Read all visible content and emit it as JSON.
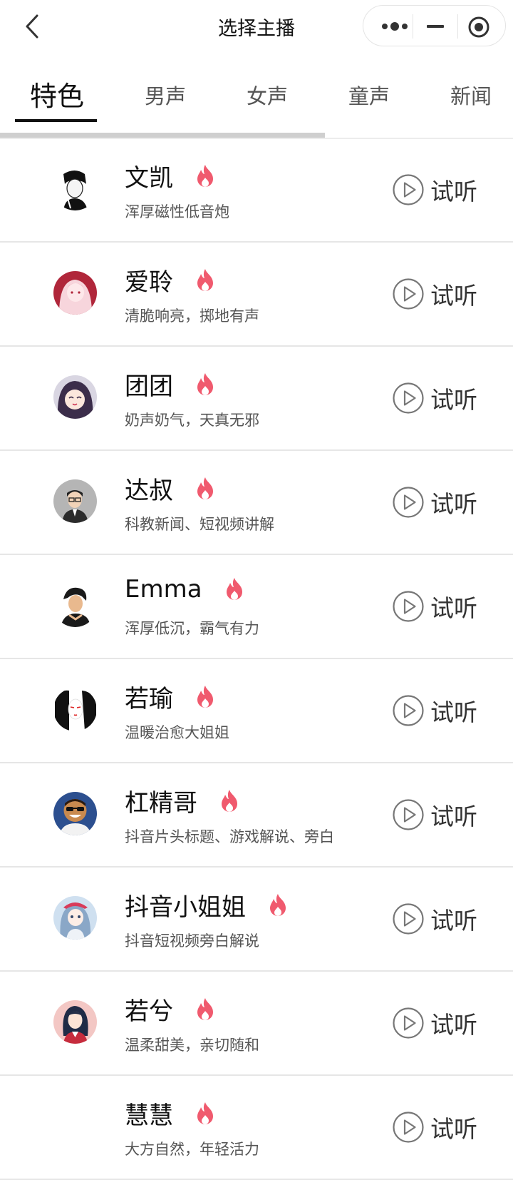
{
  "nav": {
    "title": "选择主播",
    "back_icon": "chevron-left-icon",
    "capsule": {
      "more_icon": "more-dots-icon",
      "minimize_icon": "minimize-icon",
      "close_icon": "target-circle-icon"
    }
  },
  "tabs": [
    {
      "label": "特色",
      "active": true
    },
    {
      "label": "男声",
      "active": false
    },
    {
      "label": "女声",
      "active": false
    },
    {
      "label": "童声",
      "active": false
    },
    {
      "label": "新闻",
      "active": false
    }
  ],
  "listen_label": "试听",
  "hot_icon": "fire-icon",
  "play_icon": "play-circle-icon",
  "colors": {
    "fire": "#f05a6e",
    "active_tab": "#111111",
    "scroll_track": "#cfcfcf"
  },
  "anchors": [
    {
      "name": "文凯",
      "desc": "浑厚磁性低音炮"
    },
    {
      "name": "爱聆",
      "desc": "清脆响亮，掷地有声"
    },
    {
      "name": "团团",
      "desc": "奶声奶气，天真无邪"
    },
    {
      "name": "达叔",
      "desc": "科教新闻、短视频讲解"
    },
    {
      "name": "Emma",
      "desc": "浑厚低沉，霸气有力"
    },
    {
      "name": "若瑜",
      "desc": "温暖治愈大姐姐"
    },
    {
      "name": "杠精哥",
      "desc": "抖音片头标题、游戏解说、旁白"
    },
    {
      "name": "抖音小姐姐",
      "desc": "抖音短视频旁白解说"
    },
    {
      "name": "若兮",
      "desc": "温柔甜美，亲切随和"
    },
    {
      "name": "慧慧",
      "desc": "大方自然，年轻活力"
    }
  ]
}
